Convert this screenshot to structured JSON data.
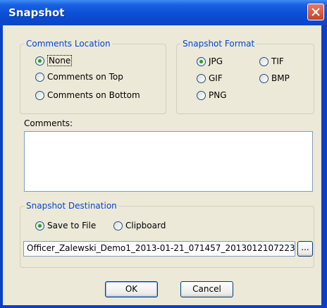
{
  "window": {
    "title": "Snapshot"
  },
  "comments_location": {
    "legend": "Comments Location",
    "options": [
      "None",
      "Comments on Top",
      "Comments on Bottom"
    ],
    "selected": "None"
  },
  "snapshot_format": {
    "legend": "Snapshot Format",
    "options": [
      "JPG",
      "TIF",
      "GIF",
      "BMP",
      "PNG"
    ],
    "selected": "JPG"
  },
  "comments": {
    "label": "Comments:",
    "value": ""
  },
  "snapshot_destination": {
    "legend": "Snapshot Destination",
    "options": [
      "Save to File",
      "Clipboard"
    ],
    "selected": "Save to File",
    "file_path": "Officer_Zalewski_Demo1_2013-01-21_071457_2013012107223",
    "browse_label": "..."
  },
  "buttons": {
    "ok": "OK",
    "cancel": "Cancel"
  },
  "colors": {
    "title_bar": "#0b4fd6",
    "dialog_bg": "#ece9d8",
    "legend_text": "#0046d5",
    "radio_dot": "#21a121",
    "close_button": "#c7422a"
  }
}
